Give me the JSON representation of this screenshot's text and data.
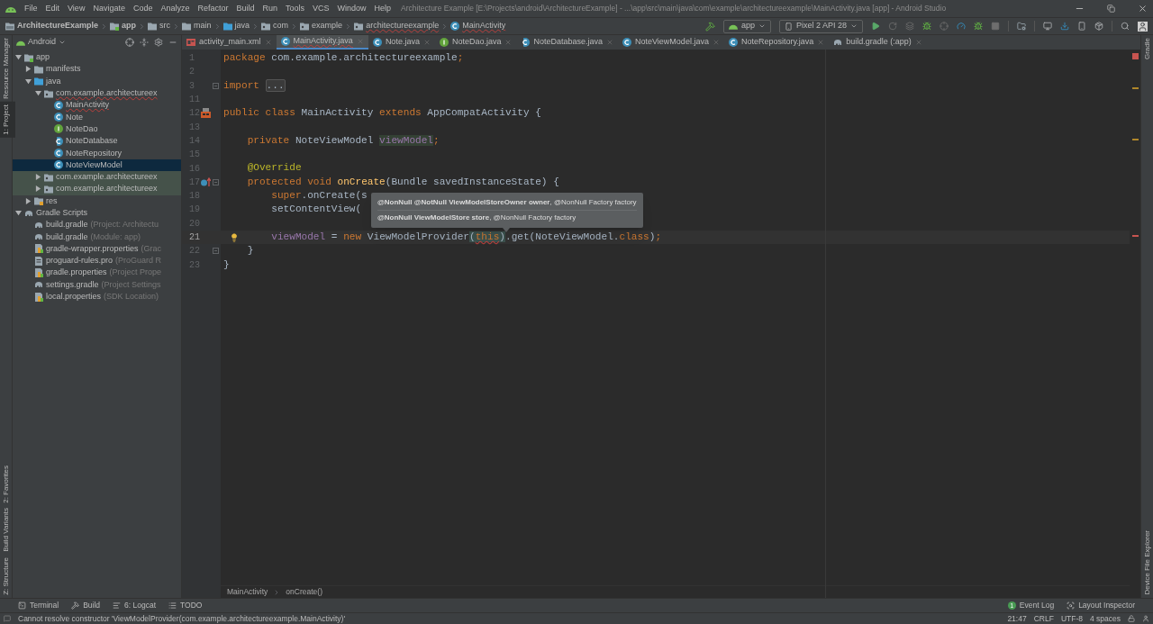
{
  "menu_bar": {
    "items": [
      "File",
      "Edit",
      "View",
      "Navigate",
      "Code",
      "Analyze",
      "Refactor",
      "Build",
      "Run",
      "Tools",
      "VCS",
      "Window",
      "Help"
    ],
    "title": "Architecture Example [E:\\Projects\\android\\ArchitectureExample] - ...\\app\\src\\main\\java\\com\\example\\architectureexample\\MainActivity.java [app] - Android Studio"
  },
  "nav_bar": {
    "breadcrumbs": [
      {
        "label": "ArchitectureExample",
        "kind": "project",
        "bold": true,
        "error": false
      },
      {
        "label": "app",
        "kind": "module",
        "bold": true,
        "error": false
      },
      {
        "label": "src",
        "kind": "folder",
        "bold": false,
        "error": false
      },
      {
        "label": "main",
        "kind": "folder",
        "bold": false,
        "error": false
      },
      {
        "label": "java",
        "kind": "source",
        "bold": false,
        "error": false
      },
      {
        "label": "com",
        "kind": "package",
        "bold": false,
        "error": false
      },
      {
        "label": "example",
        "kind": "package",
        "bold": false,
        "error": false
      },
      {
        "label": "architectureexample",
        "kind": "package",
        "bold": false,
        "error": true
      },
      {
        "label": "MainActivity",
        "kind": "class",
        "bold": false,
        "error": true
      }
    ],
    "run_config": "app",
    "device": "Pixel 2 API 28"
  },
  "left_strip": {
    "top": [
      {
        "label": "Resource Manager",
        "selected": false
      },
      {
        "label": "1: Project",
        "selected": true
      }
    ],
    "bottom": [
      {
        "label": "2: Favorites",
        "selected": false
      },
      {
        "label": "Build Variants",
        "selected": false
      },
      {
        "label": "Z: Structure",
        "selected": false
      }
    ]
  },
  "project_panel": {
    "view": "Android",
    "tree": [
      {
        "label": "app",
        "kind": "module",
        "expanded": true,
        "children": [
          {
            "label": "manifests",
            "kind": "folder",
            "expanded": false
          },
          {
            "label": "java",
            "kind": "source",
            "expanded": true,
            "children": [
              {
                "label": "com.example.architectureex",
                "kind": "package",
                "expanded": true,
                "error": true,
                "children": [
                  {
                    "label": "MainActivity",
                    "kind": "class",
                    "error": true,
                    "selected": false
                  },
                  {
                    "label": "Note",
                    "kind": "class",
                    "error": false,
                    "selected": false
                  },
                  {
                    "label": "NoteDao",
                    "kind": "interface",
                    "error": false,
                    "selected": false
                  },
                  {
                    "label": "NoteDatabase",
                    "kind": "abstract",
                    "error": false,
                    "selected": false
                  },
                  {
                    "label": "NoteRepository",
                    "kind": "class",
                    "error": false,
                    "selected": false
                  },
                  {
                    "label": "NoteViewModel",
                    "kind": "class",
                    "error": false,
                    "selected": true
                  }
                ]
              },
              {
                "label": "com.example.architectureex",
                "kind": "package",
                "expanded": false,
                "test": true
              },
              {
                "label": "com.example.architectureex",
                "kind": "package",
                "expanded": false,
                "test": true
              }
            ]
          },
          {
            "label": "res",
            "kind": "res",
            "expanded": false
          }
        ]
      },
      {
        "label": "Gradle Scripts",
        "kind": "gradle",
        "expanded": true,
        "children": [
          {
            "label": "build.gradle",
            "note": "(Project: Architectu",
            "kind": "gradle"
          },
          {
            "label": "build.gradle",
            "note": "(Module: app)",
            "kind": "gradle"
          },
          {
            "label": "gradle-wrapper.properties",
            "note": "(Grac",
            "kind": "properties"
          },
          {
            "label": "proguard-rules.pro",
            "note": "(ProGuard R",
            "kind": "file"
          },
          {
            "label": "gradle.properties",
            "note": "(Project Prope",
            "kind": "properties"
          },
          {
            "label": "settings.gradle",
            "note": "(Project Settings",
            "kind": "gradle"
          },
          {
            "label": "local.properties",
            "note": "(SDK Location)",
            "kind": "properties"
          }
        ]
      }
    ]
  },
  "editor": {
    "tabs": [
      {
        "label": "activity_main.xml",
        "kind": "layout",
        "selected": false,
        "error": false
      },
      {
        "label": "MainActivity.java",
        "kind": "class",
        "selected": true,
        "error": true
      },
      {
        "label": "Note.java",
        "kind": "class",
        "selected": false,
        "error": false
      },
      {
        "label": "NoteDao.java",
        "kind": "interface",
        "selected": false,
        "error": false
      },
      {
        "label": "NoteDatabase.java",
        "kind": "abstract",
        "selected": false,
        "error": false
      },
      {
        "label": "NoteViewModel.java",
        "kind": "class",
        "selected": false,
        "error": false
      },
      {
        "label": "NoteRepository.java",
        "kind": "class",
        "selected": false,
        "error": false
      },
      {
        "label": "build.gradle (:app)",
        "kind": "gradle",
        "selected": false,
        "error": false
      }
    ],
    "lines": [
      {
        "number": "1",
        "tokens": [
          {
            "text": "package",
            "kind": "keyword"
          },
          {
            "text": " com.example.architectureexample",
            "kind": "plain"
          },
          {
            "text": ";",
            "kind": "keyword"
          }
        ]
      },
      {
        "number": "2"
      },
      {
        "number": "3",
        "fold": true,
        "tokens": [
          {
            "text": "import ",
            "kind": "keyword"
          },
          {
            "text": "...",
            "kind": "folded"
          }
        ]
      },
      {
        "number": "11"
      },
      {
        "number": "12",
        "kind": "activity",
        "tokens": [
          {
            "text": "public class",
            "kind": "keyword"
          },
          {
            "text": " MainActivity ",
            "kind": "plain"
          },
          {
            "text": "extends",
            "kind": "keyword"
          },
          {
            "text": " AppCompatActivity {",
            "kind": "plain"
          }
        ]
      },
      {
        "number": "13"
      },
      {
        "number": "14",
        "tokens": [
          {
            "text": "    private",
            "kind": "keyword"
          },
          {
            "text": " NoteViewModel ",
            "kind": "plain"
          },
          {
            "text": "viewModel",
            "kind": "field-marked"
          },
          {
            "text": ";",
            "kind": "keyword"
          }
        ]
      },
      {
        "number": "15"
      },
      {
        "number": "16",
        "tokens": [
          {
            "text": "    @Override",
            "kind": "annotation"
          }
        ]
      },
      {
        "number": "17",
        "kind": "override",
        "fold": true,
        "tokens": [
          {
            "text": "    protected void ",
            "kind": "keyword"
          },
          {
            "text": "onCreate",
            "kind": "method"
          },
          {
            "text": "(Bundle savedInstanceState) {",
            "kind": "plain"
          }
        ]
      },
      {
        "number": "18",
        "tokens": [
          {
            "text": "        super",
            "kind": "keyword"
          },
          {
            "text": ".onCreate(s",
            "kind": "plain"
          }
        ]
      },
      {
        "number": "19",
        "tokens": [
          {
            "text": "        setContentView(",
            "kind": "plain"
          }
        ]
      },
      {
        "number": "20"
      },
      {
        "number": "21",
        "current": true,
        "kind": "bulb",
        "tokens": [
          {
            "text": "        viewModel",
            "kind": "field"
          },
          {
            "text": " = ",
            "kind": "plain"
          },
          {
            "text": "new",
            "kind": "keyword"
          },
          {
            "text": " ViewModelProvider",
            "kind": "plain"
          },
          {
            "text": "(",
            "kind": "brace"
          },
          {
            "text": "this",
            "kind": "keyword-error"
          },
          {
            "text": ")",
            "kind": "brace"
          },
          {
            "text": ".get(NoteViewModel.",
            "kind": "plain"
          },
          {
            "text": "class",
            "kind": "keyword"
          },
          {
            "text": ")",
            "kind": "plain"
          },
          {
            "text": ";",
            "kind": "keyword"
          }
        ]
      },
      {
        "number": "22",
        "fold": true,
        "tokens": [
          {
            "text": "    }",
            "kind": "plain"
          }
        ]
      },
      {
        "number": "23",
        "tokens": [
          {
            "text": "}",
            "kind": "plain"
          }
        ]
      }
    ],
    "tooltip": {
      "rows": [
        "**@NonNull @NotNull ViewModelStoreOwner owner**, @NonNull Factory factory",
        "**@NonNull ViewModelStore store**, @NonNull Factory factory"
      ]
    },
    "breadcrumb": [
      "MainActivity",
      "onCreate()"
    ]
  },
  "right_strip": {
    "top": [
      {
        "label": "Gradle",
        "selected": false
      }
    ],
    "bottom": [
      {
        "label": "Device File Explorer",
        "selected": false
      }
    ]
  },
  "tool_tabs": {
    "left": [
      {
        "label": "Terminal",
        "kind": "terminal"
      },
      {
        "label": "Build",
        "kind": "hammer"
      },
      {
        "label": "6: Logcat",
        "kind": "logcat"
      },
      {
        "label": "TODO",
        "kind": "list"
      }
    ],
    "right": [
      {
        "label": "Event Log",
        "kind": "badge",
        "badge": "1"
      },
      {
        "label": "Layout Inspector",
        "kind": "inspector"
      }
    ]
  },
  "status_bar": {
    "message": "Cannot resolve constructor 'ViewModelProvider(com.example.architectureexample.MainActivity)'",
    "items": [
      "21:47",
      "CRLF",
      "UTF-8",
      "4 spaces"
    ]
  }
}
